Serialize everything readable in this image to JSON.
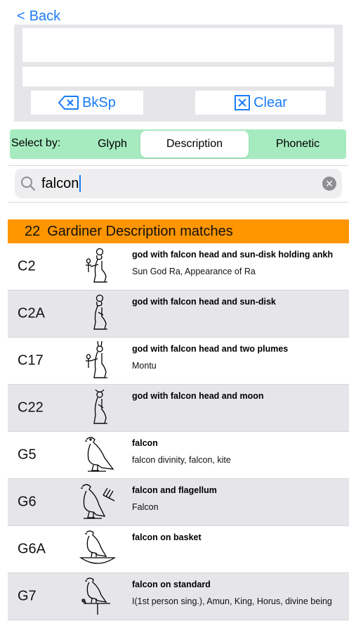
{
  "nav": {
    "back_label": "Back"
  },
  "editor": {
    "bksp_label": "BkSp",
    "clear_label": "Clear"
  },
  "select_by": {
    "label": "Select by:",
    "options": [
      "Glyph",
      "Description",
      "Phonetic"
    ],
    "selected": "Description"
  },
  "search": {
    "value": "falcon"
  },
  "results": {
    "count": "22",
    "title": "Gardiner Description matches",
    "rows": [
      {
        "code": "C2",
        "description": "god with falcon head and sun-disk holding ankh",
        "notes": "Sun God Ra, Appearance of Ra",
        "glyph_icon": "seated-falcon-god-ankh"
      },
      {
        "code": "C2A",
        "description": "god with falcon head and sun-disk",
        "notes": "",
        "glyph_icon": "seated-falcon-god"
      },
      {
        "code": "C17",
        "description": "god with falcon head and two plumes",
        "notes": "Montu",
        "glyph_icon": "falcon-god-plumes"
      },
      {
        "code": "C22",
        "description": "god with falcon head and moon",
        "notes": "",
        "glyph_icon": "falcon-god-moon"
      },
      {
        "code": "G5",
        "description": "falcon",
        "notes": "falcon divinity, falcon, kite",
        "glyph_icon": "falcon"
      },
      {
        "code": "G6",
        "description": "falcon and flagellum",
        "notes": "Falcon",
        "glyph_icon": "falcon-flagellum"
      },
      {
        "code": "G6A",
        "description": "falcon on basket",
        "notes": "",
        "glyph_icon": "falcon-basket"
      },
      {
        "code": "G7",
        "description": "falcon on standard",
        "notes": "I(1st person sing.), Amun, King, Horus, divine being",
        "glyph_icon": "falcon-standard"
      }
    ]
  }
}
